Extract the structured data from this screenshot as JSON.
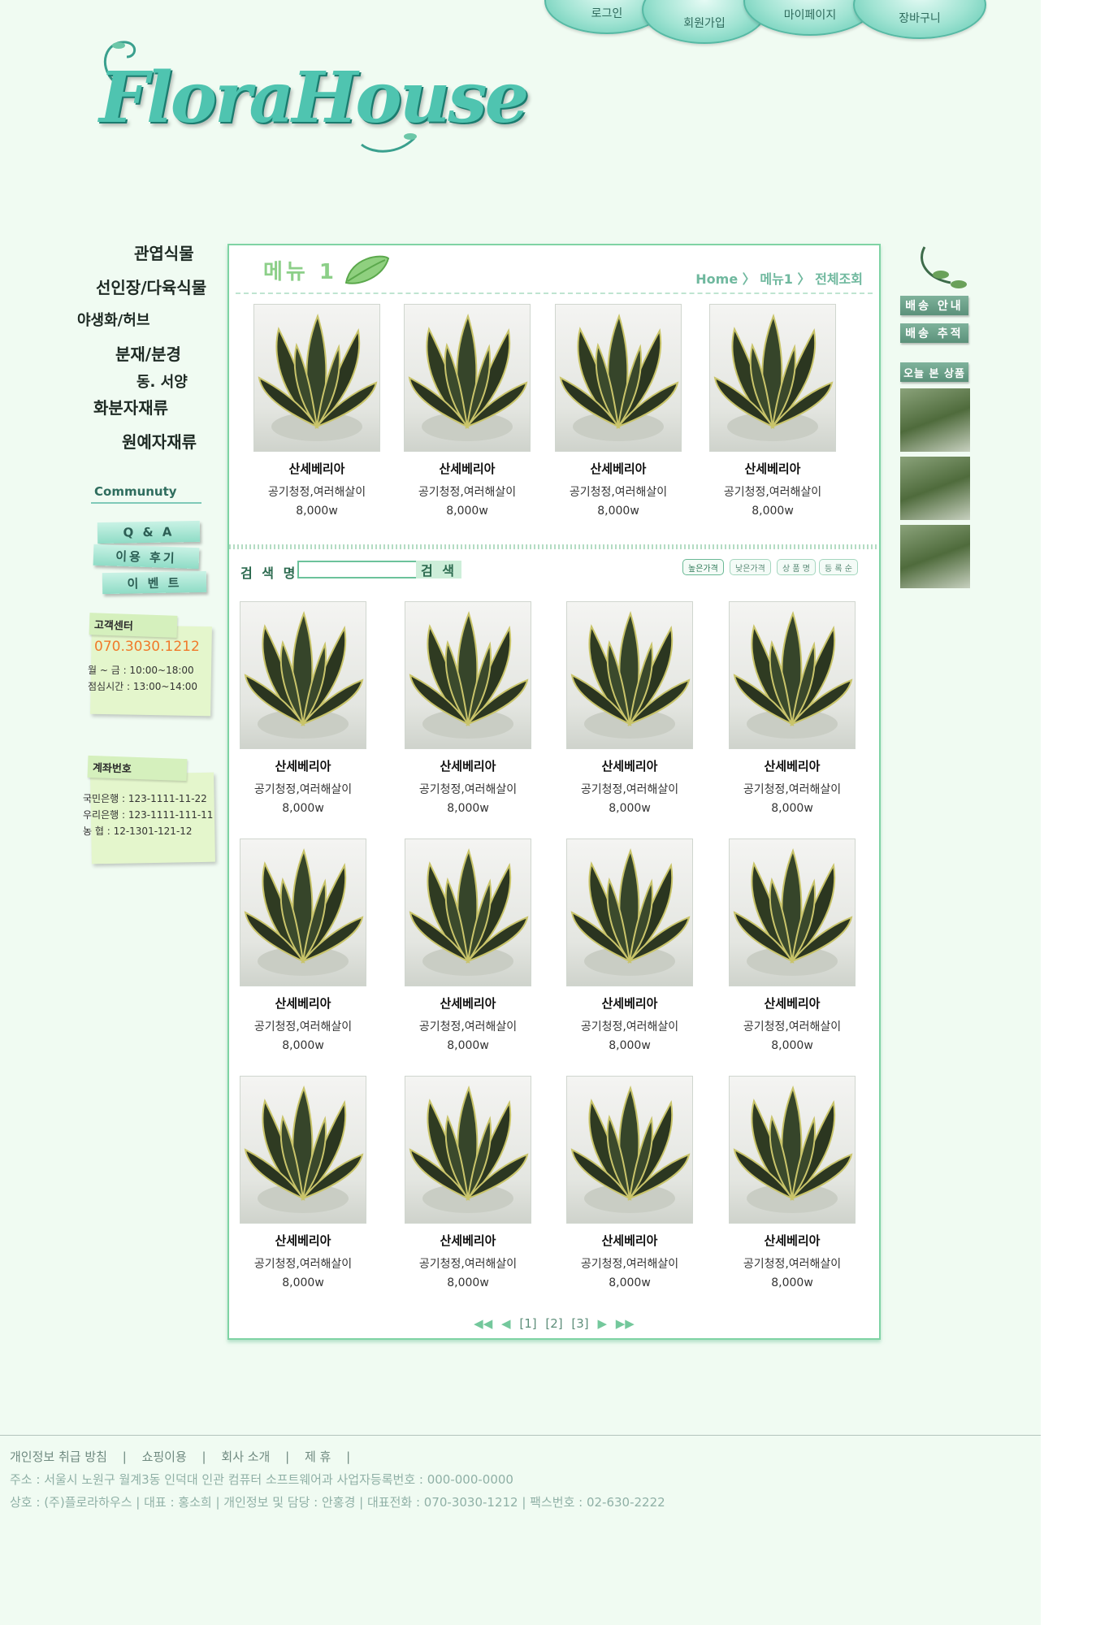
{
  "top_nav": {
    "login": "로그인",
    "signup": "회원가입",
    "mypage": "마이페이지",
    "cart": "장바구니"
  },
  "logo": {
    "text": "FloraHouse"
  },
  "categories": [
    "관엽식물",
    "선인장/다육식물",
    "야생화/허브",
    "분재/분경",
    "동. 서양",
    "화분자재류",
    "원예자재류"
  ],
  "community": {
    "title": "Communuty",
    "buttons": [
      "Q & A",
      "이용 후기",
      "이 벤 트"
    ]
  },
  "customer_center": {
    "title": "고객센터",
    "phone": "070.3030.1212",
    "hours": "월 ~ 금 : 10:00~18:00",
    "lunch": "점심시간 : 13:00~14:00"
  },
  "account": {
    "title": "계좌번호",
    "lines": [
      "국민은행 : 123-1111-11-22",
      "우리은행 : 123-1111-111-11",
      "농    협 : 12-1301-121-12"
    ]
  },
  "main": {
    "menu_title": "메뉴 1",
    "breadcrumb": {
      "home": "Home",
      "sep": "〉",
      "menu": "메뉴1",
      "current": "전체조회"
    },
    "search": {
      "label": "검 색 명",
      "value": "",
      "button": "검 색"
    },
    "sort_options": [
      "높은가격",
      "낮은가격",
      "상 품 명",
      "등 록 순"
    ],
    "featured": [
      {
        "name": "산세베리아",
        "desc": "공기청정,여러해살이",
        "price": "8,000w"
      },
      {
        "name": "산세베리아",
        "desc": "공기청정,여러해살이",
        "price": "8,000w"
      },
      {
        "name": "산세베리아",
        "desc": "공기청정,여러해살이",
        "price": "8,000w"
      },
      {
        "name": "산세베리아",
        "desc": "공기청정,여러해살이",
        "price": "8,000w"
      }
    ],
    "products": [
      {
        "name": "산세베리아",
        "desc": "공기청정,여러해살이",
        "price": "8,000w"
      },
      {
        "name": "산세베리아",
        "desc": "공기청정,여러해살이",
        "price": "8,000w"
      },
      {
        "name": "산세베리아",
        "desc": "공기청정,여러해살이",
        "price": "8,000w"
      },
      {
        "name": "산세베리아",
        "desc": "공기청정,여러해살이",
        "price": "8,000w"
      },
      {
        "name": "산세베리아",
        "desc": "공기청정,여러해살이",
        "price": "8,000w"
      },
      {
        "name": "산세베리아",
        "desc": "공기청정,여러해살이",
        "price": "8,000w"
      },
      {
        "name": "산세베리아",
        "desc": "공기청정,여러해살이",
        "price": "8,000w"
      },
      {
        "name": "산세베리아",
        "desc": "공기청정,여러해살이",
        "price": "8,000w"
      },
      {
        "name": "산세베리아",
        "desc": "공기청정,여러해살이",
        "price": "8,000w"
      },
      {
        "name": "산세베리아",
        "desc": "공기청정,여러해살이",
        "price": "8,000w"
      },
      {
        "name": "산세베리아",
        "desc": "공기청정,여러해살이",
        "price": "8,000w"
      },
      {
        "name": "산세베리아",
        "desc": "공기청정,여러해살이",
        "price": "8,000w"
      }
    ],
    "pagination": {
      "first": "◀◀",
      "prev": "◀",
      "pages": [
        "[1]",
        "[2]",
        "[3]"
      ],
      "next": "▶",
      "last": "▶▶"
    }
  },
  "right_column": {
    "shipping_info": "배송 안내",
    "shipping_track": "배송 추적",
    "recent": "오늘 본 상품"
  },
  "footer": {
    "links": [
      "개인정보 취급 방침",
      "|",
      "쇼핑이용",
      "|",
      "회사 소개",
      "|",
      "제 휴",
      "|"
    ],
    "address": "주소 : 서울시 노원구 월계3동 인덕대 인관 컴퓨터 소프트웨어과    사업자등록번호 : 000-000-0000",
    "company": "상호 : (주)플로라하우스 | 대표 : 홍소희 | 개인정보 및 담당 : 안홍경  |  대표전화 : 070-3030-1212  | 팩스번호 : 02-630-2222"
  }
}
